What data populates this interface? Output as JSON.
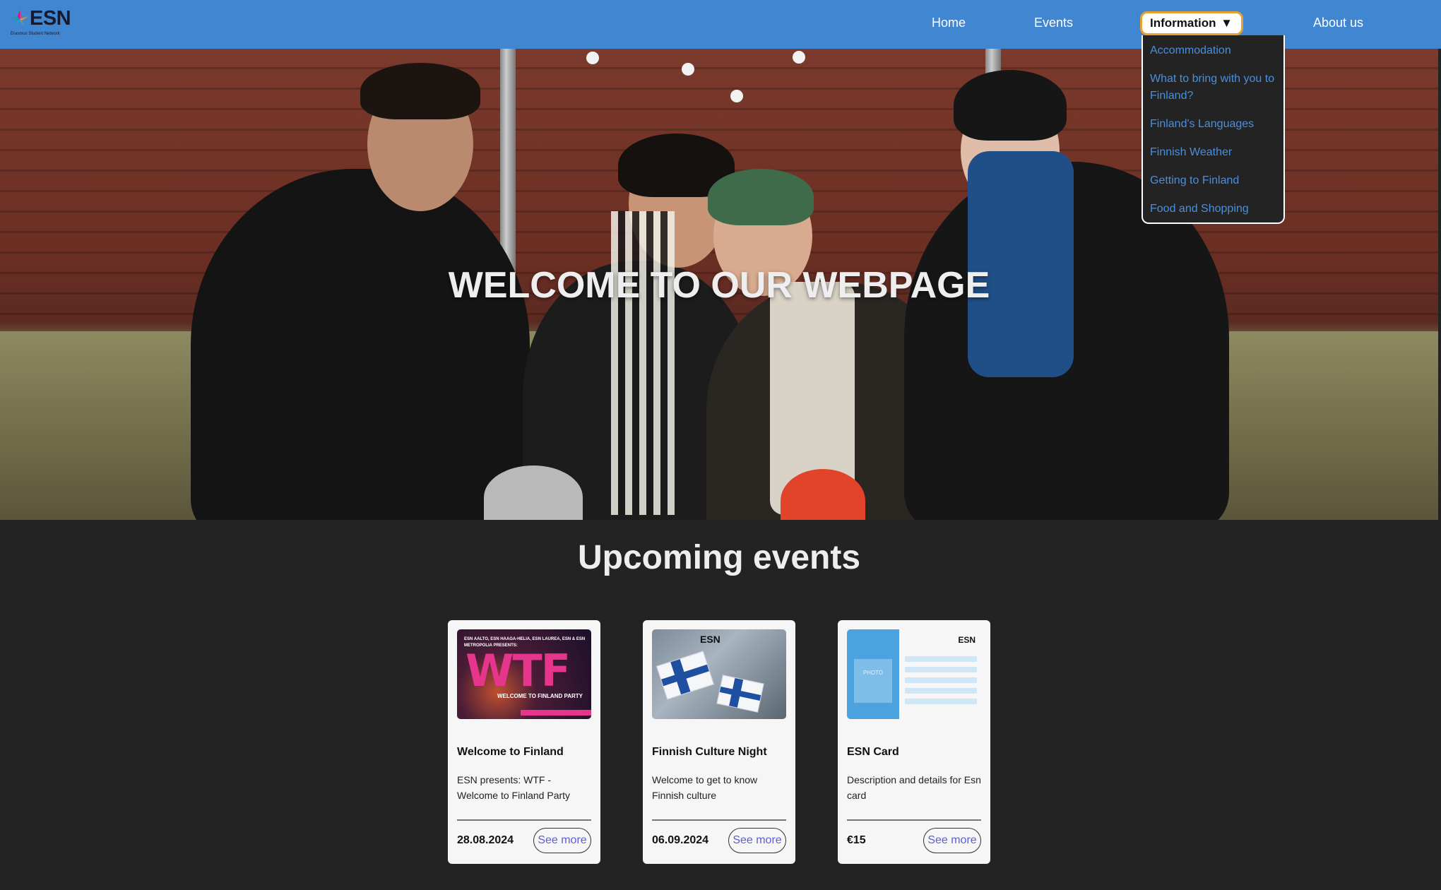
{
  "brand": {
    "name": "ESN",
    "subtitle": "Erasmus Student Network"
  },
  "nav": {
    "home": "Home",
    "events": "Events",
    "information": "Information",
    "information_caret": "▼",
    "about": "About us"
  },
  "dropdown": {
    "items": [
      "Accommodation",
      "What to bring with you to Finland?",
      "Finland's Languages",
      "Finnish Weather",
      "Getting to Finland",
      "Food and Shopping"
    ]
  },
  "hero": {
    "title": "WELCOME TO OUR WEBPAGE"
  },
  "events": {
    "heading": "Upcoming events",
    "cards": [
      {
        "title": "Welcome to Finland",
        "description": "ESN presents: WTF - Welcome to Finland Party",
        "meta": "28.08.2024",
        "button": "See more",
        "image": {
          "top_text": "ESN AALTO, ESN HAAGA-HELIA, ESN LAUREA, ESN & ESN METROPOLIA PRESENTS:",
          "big_text": "WTF",
          "right_text": "WELCOME TO FINLAND PARTY"
        }
      },
      {
        "title": "Finnish Culture Night",
        "description": "Welcome to get to know Finnish culture",
        "meta": "06.09.2024",
        "button": "See more",
        "image": {
          "brand": "ESN"
        }
      },
      {
        "title": "ESN Card",
        "description": "Description and details for Esn card",
        "meta": "€15",
        "button": "See more",
        "image": {
          "brand": "ESN",
          "photo_label": "PHOTO"
        }
      }
    ]
  },
  "colors": {
    "navbar": "#4186d1",
    "page_background": "#232323",
    "dropdown_link": "#4a8fdc",
    "active_border": "#e6a22c",
    "see_more_text": "#5b5fd6"
  }
}
